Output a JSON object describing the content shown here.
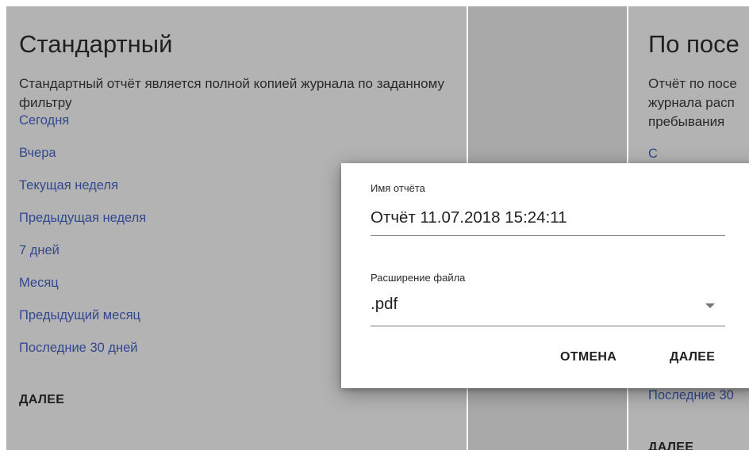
{
  "left_card": {
    "title": "Стандартный",
    "description": "Стандартный отчёт является полной копией журнала по заданному фильтру",
    "links": [
      "Сегодня",
      "Вчера",
      "Текущая неделя",
      "Предыдущая неделя",
      "7 дней",
      "Месяц",
      "Предыдущий месяц",
      "Последние 30 дней"
    ],
    "next_label": "ДАЛЕЕ"
  },
  "right_card": {
    "title": "По посе",
    "description_lines": [
      "Отчёт по посе",
      "журнала расп",
      "пребывания"
    ],
    "partial_link": "С",
    "last_link": "Последние 30",
    "next_label": "ДАЛЕЕ"
  },
  "dialog": {
    "report_name_label": "Имя отчёта",
    "report_name_value": "Отчёт 11.07.2018 15:24:11",
    "extension_label": "Расширение файла",
    "extension_value": ".pdf",
    "cancel_label": "ОТМЕНА",
    "next_label": "ДАЛЕЕ"
  },
  "colors": {
    "overlay_card": "#b3b3b3",
    "link": "#33488f",
    "dialog_bg": "#ffffff"
  }
}
